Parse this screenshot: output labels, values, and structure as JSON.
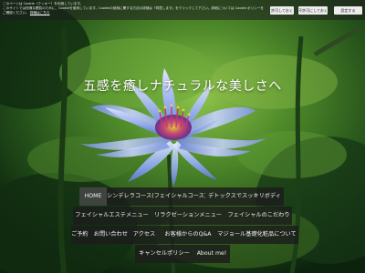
{
  "cookie_banner": {
    "message_1": "このページは Cookie（クッキー）を利用しています。",
    "message_2": "このサイトでは快適な閲覧のために、Cookieを使用しています。Cookieの使用に関する方法の詳細は「同意します」をクリックして下さい。詳細については Cookie ポリシーをご確認ください。",
    "detail_link": "詳細はこちら",
    "accept_label": "許可しておく",
    "reject_label": "不許可にしておく",
    "settings_label": "設定する"
  },
  "site": {
    "title": "五感を癒しナチュラルな美しさへ"
  },
  "nav": {
    "items": [
      {
        "label": "HOME"
      },
      {
        "label": "シンデレラコース(フェイシャルコース)"
      },
      {
        "label": "デトックスでスッキリボディ"
      },
      {
        "label": "フェイシャルエステメニュー"
      },
      {
        "label": "リラクゼーションメニュー"
      },
      {
        "label": "フェイシャルのこだわり"
      },
      {
        "label": "ご予約　お問い合わせ"
      },
      {
        "label": "アクセス"
      },
      {
        "label": "お客様からのQ&A"
      },
      {
        "label": "マジョール基礎化粧品について"
      },
      {
        "label": "キャンセルポリシー"
      },
      {
        "label": "About me!"
      }
    ]
  },
  "colors": {
    "nav_background": "#1c1c1c",
    "nav_text": "#f2f2f2",
    "title_text": "#ffffff",
    "flower_petal": "#9fb6f0",
    "flower_center": "#c23a7a",
    "flower_stamen": "#e8d23a"
  }
}
